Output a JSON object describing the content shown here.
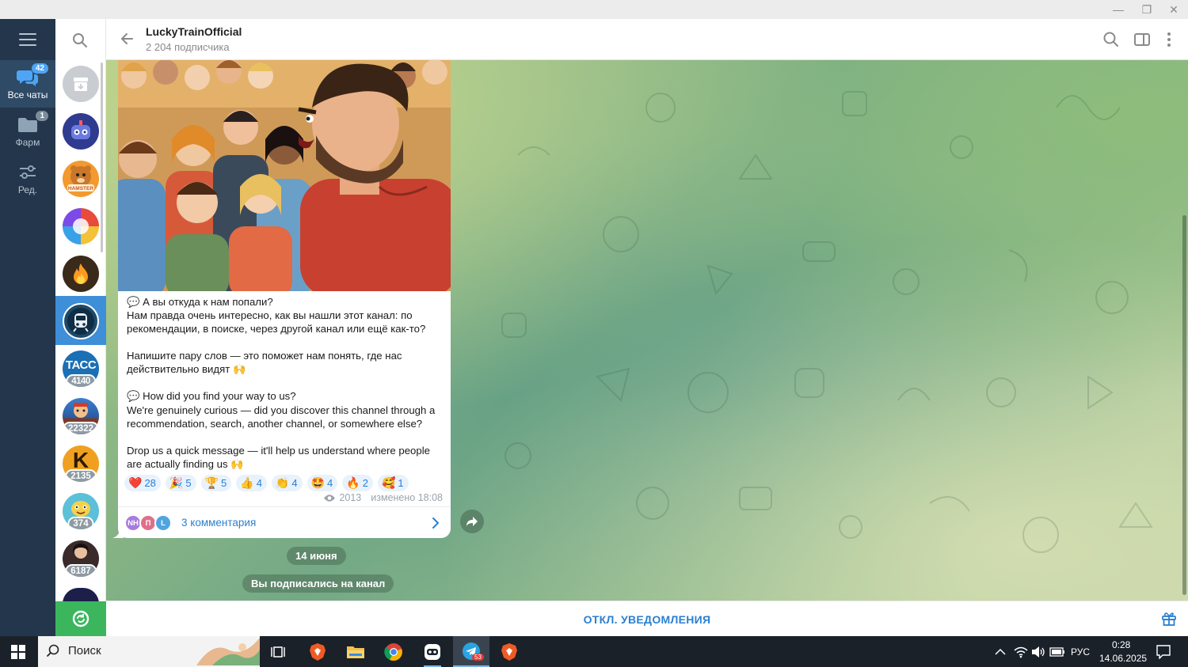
{
  "window": {
    "minimize_glyph": "—",
    "restore_glyph": "❐",
    "close_glyph": "✕"
  },
  "folders": [
    {
      "label": "Все чаты",
      "badge": "42",
      "icon": "chats-icon"
    },
    {
      "label": "Фарм",
      "badge": "1",
      "icon": "folder-icon"
    },
    {
      "label": "Ред.",
      "badge": "",
      "icon": "filters-edit-icon"
    }
  ],
  "chat_list": [
    {
      "name": "archive",
      "count": ""
    },
    {
      "name": "bot-robot",
      "count": ""
    },
    {
      "name": "hamster-kombat",
      "count": "",
      "avatar_text": "HAMSTER"
    },
    {
      "name": "colorful-app",
      "count": ""
    },
    {
      "name": "fire-channel",
      "count": ""
    },
    {
      "name": "luckytrain",
      "count": ""
    },
    {
      "name": "tass",
      "count": "4140",
      "avatar_text": "ТАСС"
    },
    {
      "name": "game-channel",
      "count": "22322"
    },
    {
      "name": "k-channel",
      "count": "2135",
      "avatar_text": "K"
    },
    {
      "name": "cartoon-channel",
      "count": "374"
    },
    {
      "name": "person-channel",
      "count": "6187"
    }
  ],
  "header": {
    "title": "LuckyTrainOfficial",
    "subtitle": "2 204 подписчика"
  },
  "message": {
    "paragraphs": [
      "💬 А вы откуда к нам попали?\nНам правда очень интересно, как вы нашли этот канал: по рекомендации, в поиске, через другой канал или ещё как-то?",
      "Напишите пару слов — это поможет нам понять, где нас действительно видят 🙌",
      "💬 How did you find your way to us?\nWe're genuinely curious — did you discover this channel through a recommendation, search, another channel, or somewhere else?",
      "Drop us a quick message — it'll help us understand where people are actually finding us 🙌"
    ],
    "reactions": [
      {
        "emoji": "❤️",
        "count": "28"
      },
      {
        "emoji": "🎉",
        "count": "5"
      },
      {
        "emoji": "🏆",
        "count": "5"
      },
      {
        "emoji": "👍",
        "count": "4"
      },
      {
        "emoji": "👏",
        "count": "4"
      },
      {
        "emoji": "🤩",
        "count": "4"
      },
      {
        "emoji": "🔥",
        "count": "2"
      },
      {
        "emoji": "🥰",
        "count": "1"
      }
    ],
    "views": "2013",
    "edited": "изменено 18:08",
    "comment_avatars": [
      "NH",
      "П",
      "L"
    ],
    "comments_label": "3 комментария"
  },
  "service": {
    "date": "14 июня",
    "joined": "Вы подписались на канал"
  },
  "bottom": {
    "mute_label": "ОТКЛ. УВЕДОМЛЕНИЯ"
  },
  "taskbar": {
    "search_label": "Поиск",
    "lang": "РУС",
    "time": "0:28",
    "date": "14.06.2025",
    "telegram_badge": "53"
  },
  "colors": {
    "accent": "#2b7fd0",
    "rail": "#23364b",
    "selected": "#3e8ed8"
  }
}
